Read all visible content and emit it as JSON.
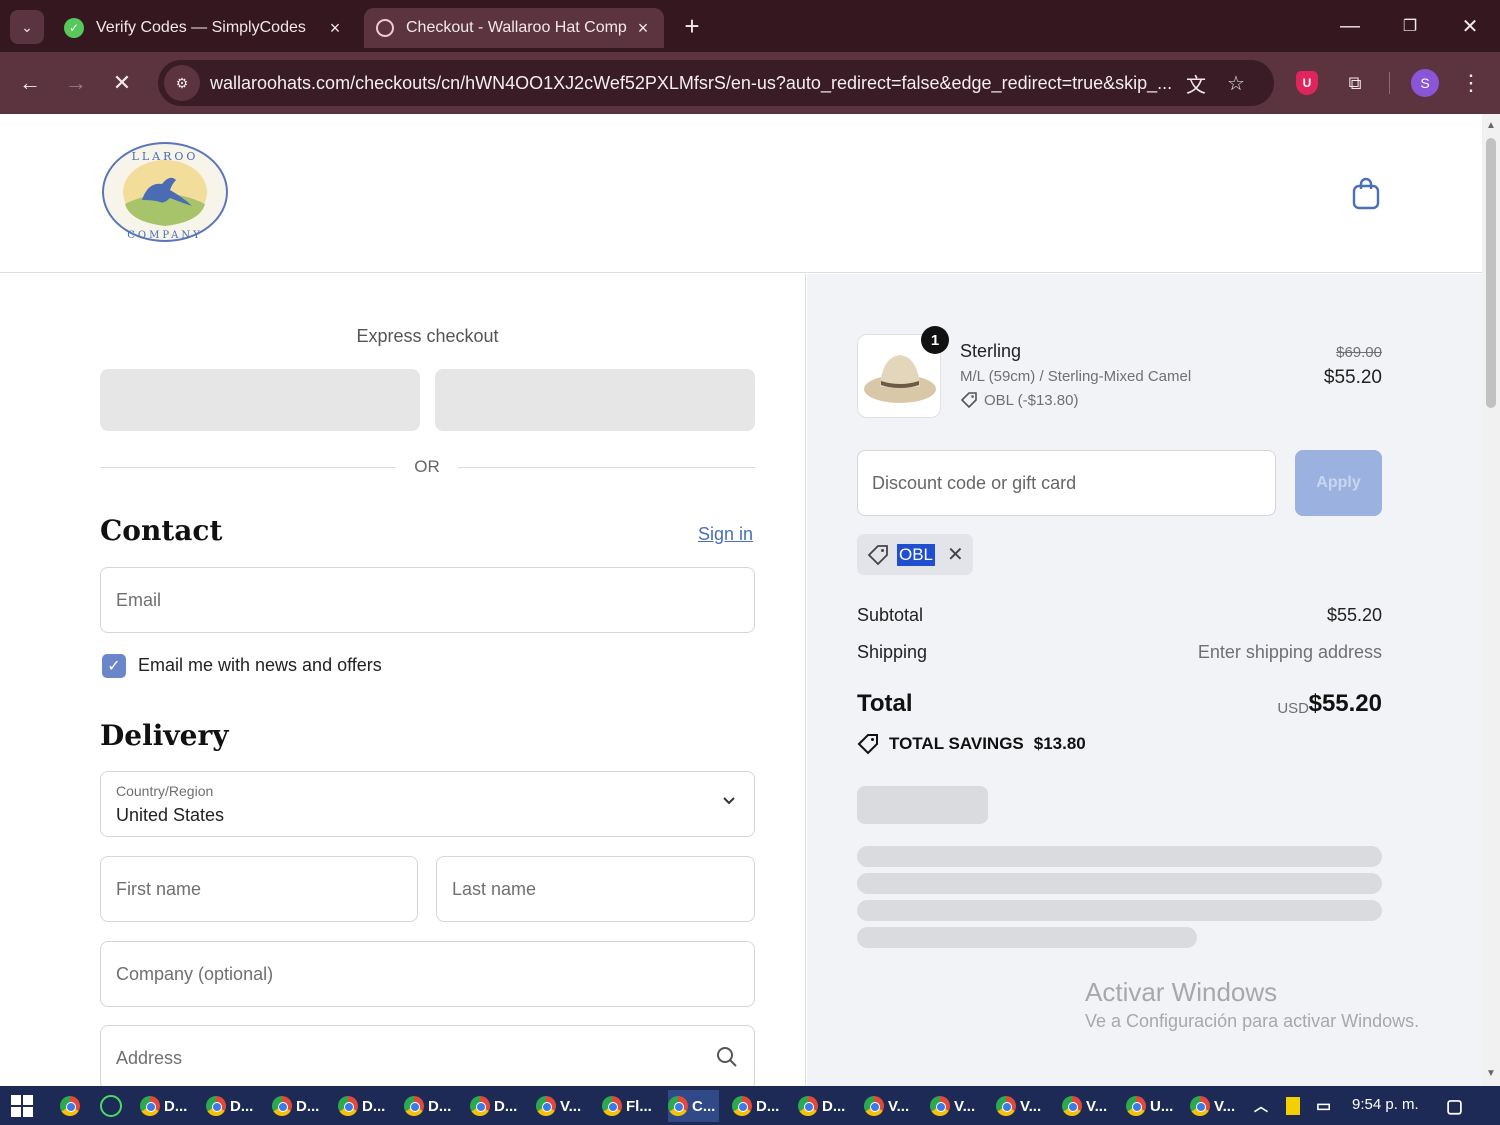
{
  "browser": {
    "tabs": [
      {
        "title": "Verify Codes — SimplyCodes",
        "active": false
      },
      {
        "title": "Checkout - Wallaroo Hat Comp",
        "active": true
      }
    ],
    "url": "wallaroohats.com/checkouts/cn/hWN4OO1XJ2cWef52PXLMfsrS/en-us?auto_redirect=false&edge_redirect=true&skip_...",
    "profile_initial": "S"
  },
  "store": {
    "logo_text": "WALLAROO HAT COMPANY"
  },
  "checkout": {
    "express_title": "Express checkout",
    "or_text": "OR",
    "contact_title": "Contact",
    "signin_label": "Sign in",
    "email_placeholder": "Email",
    "newsletter_label": "Email me with news and offers",
    "newsletter_checked": true,
    "delivery_title": "Delivery",
    "country_label": "Country/Region",
    "country_value": "United States",
    "first_name_placeholder": "First name",
    "last_name_placeholder": "Last name",
    "company_placeholder": "Company (optional)",
    "address_placeholder": "Address"
  },
  "summary": {
    "item": {
      "quantity": "1",
      "name": "Sterling",
      "variant": "M/L (59cm) / Sterling-Mixed Camel",
      "discount": "OBL (-$13.80)",
      "original_price": "$69.00",
      "price": "$55.20"
    },
    "discount_placeholder": "Discount code or gift card",
    "apply_label": "Apply",
    "applied_code": "OBL",
    "subtotal_label": "Subtotal",
    "subtotal_value": "$55.20",
    "shipping_label": "Shipping",
    "shipping_value": "Enter shipping address",
    "total_label": "Total",
    "total_currency": "USD",
    "total_value": "$55.20",
    "savings_label": "TOTAL SAVINGS",
    "savings_value": "$13.80"
  },
  "watermark": {
    "line1": "Activar Windows",
    "line2": "Ve a Configuración para activar Windows."
  },
  "taskbar": {
    "items": [
      "D...",
      "D...",
      "D...",
      "D...",
      "D...",
      "D...",
      "V...",
      "Fl...",
      "C...",
      "D...",
      "D...",
      "V...",
      "V...",
      "V...",
      "V...",
      "U...",
      "V..."
    ],
    "clock": "9:54 p. m."
  },
  "colors": {
    "accent": "#4a6fb5",
    "apply_button": "#9bb1e0",
    "browser_frame": "#5b3440"
  }
}
